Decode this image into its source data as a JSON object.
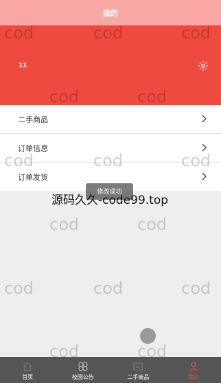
{
  "header": {
    "title": "我的"
  },
  "profile": {
    "username": "11",
    "settings_icon": "gear-icon"
  },
  "menu": {
    "items": [
      {
        "label": "二手商品"
      },
      {
        "label": "订单信息"
      },
      {
        "label": "订单发货"
      }
    ]
  },
  "toast": {
    "text": "修改成功"
  },
  "overlay": {
    "source_text": "源码久久-code99.top"
  },
  "watermark": {
    "text": "cod"
  },
  "tabbar": {
    "tabs": [
      {
        "label": "首页",
        "icon": "home-icon"
      },
      {
        "label": "校园公告",
        "icon": "clover-icon"
      },
      {
        "label": "二手商品",
        "icon": "box-icon"
      },
      {
        "label": "我的",
        "icon": "user-icon",
        "active": true
      }
    ]
  },
  "colors": {
    "accent": "#ef4a3f",
    "header": "#f9a7a5",
    "tabbar": "#555555"
  }
}
